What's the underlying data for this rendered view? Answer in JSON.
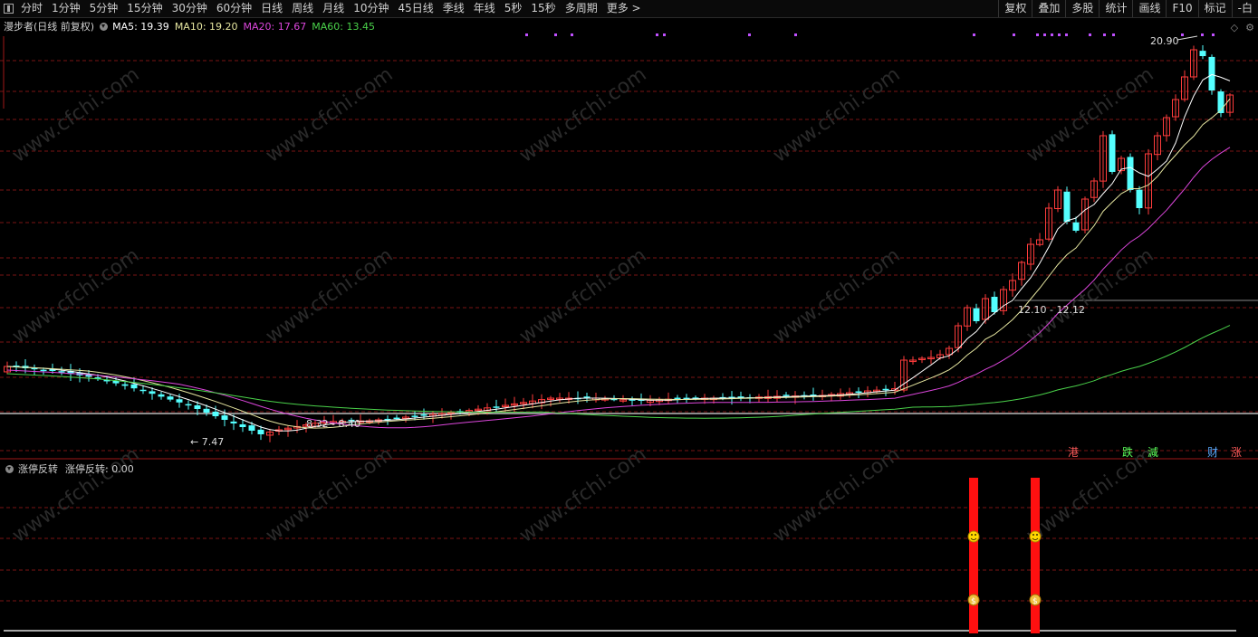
{
  "toolbar": {
    "left_items": [
      "分时",
      "1分钟",
      "5分钟",
      "15分钟",
      "30分钟",
      "60分钟",
      "日线",
      "周线",
      "月线",
      "10分钟",
      "45日线",
      "季线",
      "年线",
      "5秒",
      "15秒",
      "多周期",
      "更多 >"
    ],
    "right_items": [
      "复权",
      "叠加",
      "多股",
      "统计",
      "画线",
      "F10",
      "标记",
      "-白"
    ]
  },
  "main_chart": {
    "stock_name": "漫步者",
    "period_label": "(日线 前复权)",
    "ma5_label": "MA5: 19.39",
    "ma10_label": "MA10: 19.20",
    "ma20_label": "MA20: 17.67",
    "ma60_label": "MA60: 13.45",
    "high_label": "20.90",
    "low_label": "7.47",
    "range_label_1": "8.32 - 8.40",
    "range_label_2": "12.10 - 12.12",
    "watermark": "www.cfchi.com"
  },
  "flags": [
    {
      "text": "港",
      "color": "#ff5a5a"
    },
    {
      "text": "跌",
      "color": "#5aff5a"
    },
    {
      "text": "減",
      "color": "#5aff5a"
    },
    {
      "text": "财",
      "color": "#5aaaff"
    },
    {
      "text": "涨",
      "color": "#ff5a5a"
    }
  ],
  "sub_chart": {
    "indicator_name": "涨停反转",
    "indicator_value": "涨停反转: 0.00"
  },
  "colors": {
    "up": "#ff3c3c",
    "down": "#54ffff",
    "ma5": "#ffffff",
    "ma10": "#e6e6a0",
    "ma20": "#dc46dc",
    "ma60": "#4ad24a",
    "grid": "#7a1414"
  }
}
